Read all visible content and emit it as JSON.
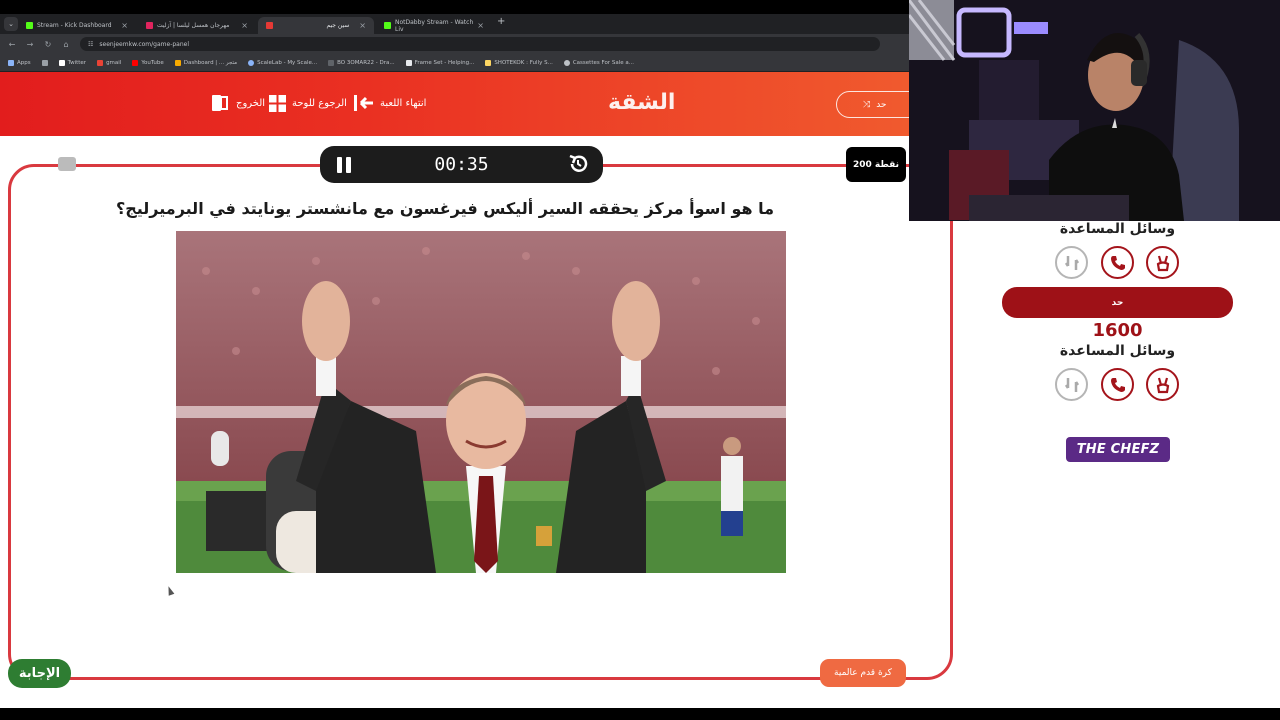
{
  "browser": {
    "tabs": [
      {
        "label": "Stream - Kick Dashboard",
        "color": "#53fc18"
      },
      {
        "label": "مهرجان همسل ليلسا | آزليت",
        "color": "#e0245e"
      },
      {
        "label": "سين جيم",
        "color": "#e53935"
      },
      {
        "label": "NotDabby Stream - Watch Liv",
        "color": "#53fc18"
      }
    ],
    "url": "seenjeemkw.com/game-panel",
    "bookmarks": [
      {
        "label": "Apps"
      },
      {
        "label": "Twitter"
      },
      {
        "label": "gmail"
      },
      {
        "label": "YouTube"
      },
      {
        "label": "Dashboard | ... متجر"
      },
      {
        "label": "ScaleLab - My Scale..."
      },
      {
        "label": "BO 3OMAR22 - Dra..."
      },
      {
        "label": "Frame Set - Helping..."
      },
      {
        "label": "SHOTEKOK : Fully S..."
      },
      {
        "label": "Cassettes For Sale a..."
      }
    ]
  },
  "header": {
    "title": "الشقة",
    "end_game": "انتهاء اللعبة",
    "back_to_board": "الرجوع للوحة",
    "exit": "الخروج",
    "turn_pill": "حد"
  },
  "board": {
    "timer": "00:35",
    "points": "200 نقطة",
    "question": "ما هو اسوأ مركز يحققه السير أليكس فيرغسون مع مانشستر يونايتد في البرميرليج؟",
    "answer_button": "الإجابة",
    "category": "كرة قدم عالمية"
  },
  "side": {
    "lifelines_label_1": "وسائل المساعدة",
    "team_name": "حد",
    "team_score": "1600",
    "lifelines_label_2": "وسائل المساعدة",
    "sponsor": "THE CHEFZ"
  },
  "colors": {
    "header_start": "#e21d1d",
    "header_end": "#f05a2e",
    "frame": "#d9393f",
    "team": "#9e1117",
    "answer": "#2e7d32",
    "category": "#ef6a42",
    "sponsor": "#5b2a86"
  }
}
